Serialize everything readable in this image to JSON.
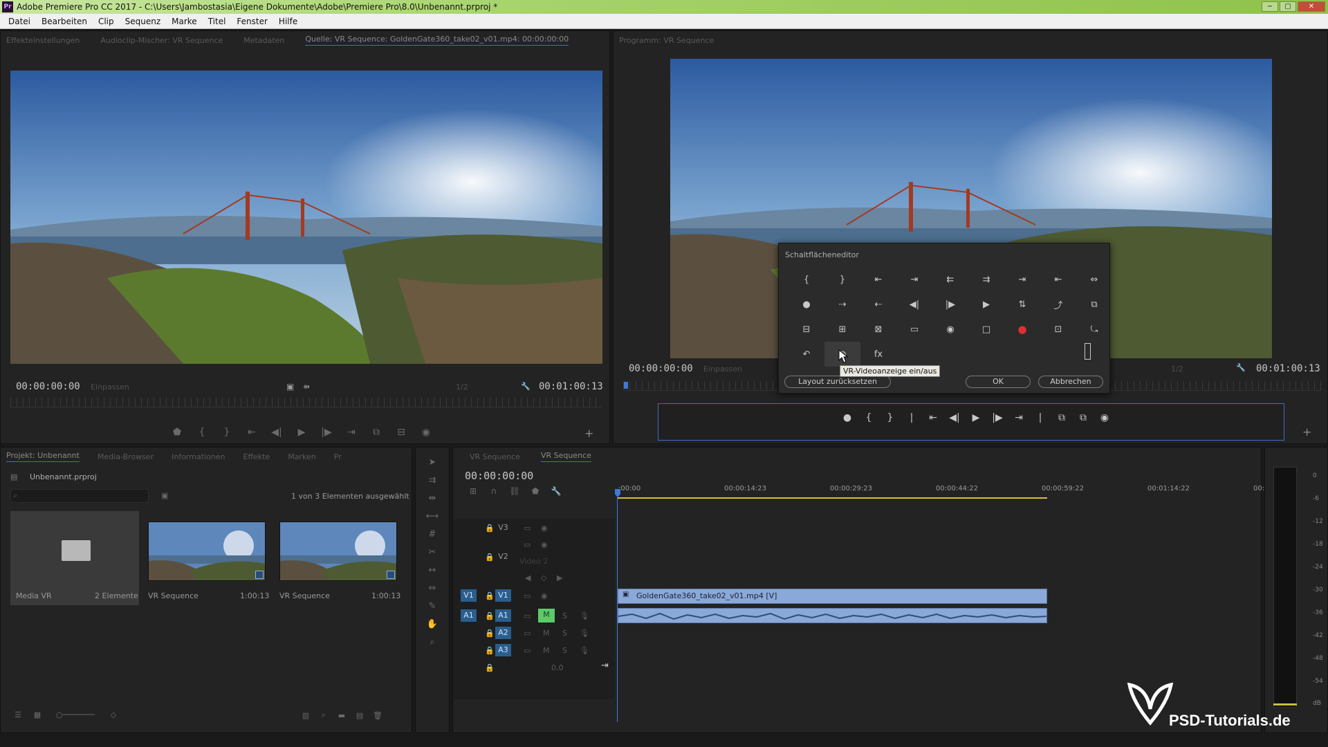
{
  "window": {
    "title": "Adobe Premiere Pro CC 2017 - C:\\Users\\Jambostasia\\Eigene Dokumente\\Adobe\\Premiere Pro\\8.0\\Unbenannt.prproj *",
    "min": "−",
    "max": "▢",
    "close": "✕"
  },
  "menu": [
    "Datei",
    "Bearbeiten",
    "Clip",
    "Sequenz",
    "Marke",
    "Titel",
    "Fenster",
    "Hilfe"
  ],
  "source_panel": {
    "tabs": [
      "Effekteinstellungen",
      "Audioclip-Mischer: VR Sequence",
      "Metadaten",
      "Quelle: VR Sequence: GoldenGate360_take02_v01.mp4: 00:00:00:00"
    ],
    "tc_in": "00:00:00:00",
    "fit": "Einpassen",
    "res": "1/2",
    "tc_dur": "00:01:00:13"
  },
  "program_panel": {
    "tab": "Programm: VR Sequence",
    "tc_in": "00:00:00:00",
    "fit": "Einpassen",
    "res": "1/2",
    "tc_dur": "00:01:00:13"
  },
  "button_editor": {
    "title": "Schaltflächeneditor",
    "icons": [
      "{",
      "}",
      "⇤",
      "⇥",
      "⇇",
      "⇉",
      "⇥",
      "⇤",
      "⇔",
      "●",
      "⇢",
      "⇠",
      "◀|",
      "|▶",
      "▶",
      "⇅",
      "⤴",
      "⧉",
      "⊟",
      "⊞",
      "⊠",
      "▭",
      "◉",
      "□",
      "●",
      "⊡",
      "⤿",
      "↶",
      "◍",
      "fx"
    ],
    "reset": "Layout zurücksetzen",
    "ok": "OK",
    "cancel": "Abbrechen",
    "tooltip": "VR-Videoanzeige ein/aus"
  },
  "program_ctrls": [
    "●",
    "{",
    "}",
    "|",
    "⇤",
    "◀|",
    "▶",
    "|▶",
    "⇥",
    "|",
    "⧉",
    "⧉",
    "◉"
  ],
  "project_panel": {
    "tabs": [
      "Projekt: Unbenannt",
      "Media-Browser",
      "Informationen",
      "Effekte",
      "Marken",
      "Pr"
    ],
    "file": "Unbenannt.prproj",
    "selection": "1 von 3 Elementen ausgewählt",
    "items": [
      {
        "name": "Media VR",
        "meta": "2 Elemente"
      },
      {
        "name": "VR Sequence",
        "meta": "1:00:13"
      },
      {
        "name": "VR Sequence",
        "meta": "1:00:13"
      }
    ]
  },
  "timeline": {
    "tabs": [
      "VR Sequence",
      "VR Sequence"
    ],
    "tc": "00:00:00:00",
    "ticks": [
      ":00:00",
      "00:00:14:23",
      "00:00:29:23",
      "00:00:44:22",
      "00:00:59:22",
      "00:01:14:22",
      "00:0("
    ],
    "tracks": {
      "v3": "V3",
      "v2": "V2",
      "v2_name": "Video 2",
      "v1_src": "V1",
      "v1": "V1",
      "a1_src": "A1",
      "a1": "A1",
      "a2": "A2",
      "a3": "A3",
      "m": "M",
      "s": "S",
      "vol": "0,0"
    },
    "clip_name": "GoldenGate360_take02_v01.mp4 [V]"
  },
  "meter_labels": [
    "0",
    "-6",
    "-12",
    "-18",
    "-24",
    "-30",
    "-36",
    "-42",
    "-48",
    "-54",
    "dB"
  ],
  "watermark": "PSD-Tutorials.de"
}
